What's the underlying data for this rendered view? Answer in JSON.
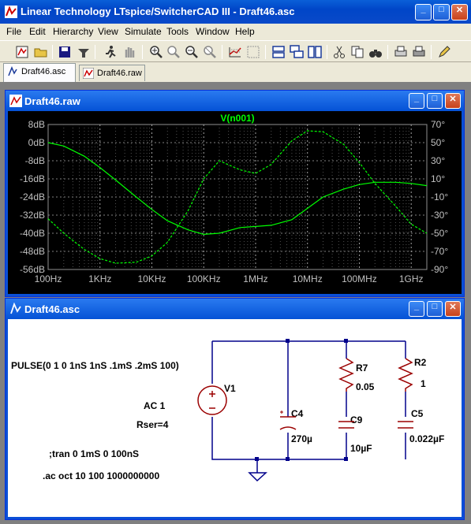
{
  "app": {
    "title": "Linear Technology LTspice/SwitcherCAD III - Draft46.asc"
  },
  "menu": [
    "File",
    "Edit",
    "Hierarchy",
    "View",
    "Simulate",
    "Tools",
    "Window",
    "Help"
  ],
  "toolbar_icons": [
    "new-schematic-icon",
    "open-icon",
    "save-icon",
    "control-panel-icon",
    "run-icon",
    "halt-icon",
    "zoom-in-icon",
    "zoom-out-icon",
    "zoom-fit-icon",
    "zoom-cancel-icon",
    "autorange-icon",
    "grid-icon",
    "tile-horizontal-icon",
    "cascade-icon",
    "tile-vertical-icon",
    "cut-icon",
    "copy-icon",
    "find-icon",
    "print-preview-icon",
    "print-icon",
    "pencil-icon"
  ],
  "tabs": [
    {
      "label": "Draft46.asc",
      "active": true
    },
    {
      "label": "Draft46.raw",
      "active": false
    }
  ],
  "wave_window": {
    "title": "Draft46.raw",
    "trace_label": "V(n001)",
    "trace_color": "#00ff00",
    "y_left_ticks": [
      "8dB",
      "0dB",
      "-8dB",
      "-16dB",
      "-24dB",
      "-32dB",
      "-40dB",
      "-48dB",
      "-56dB"
    ],
    "y_right_ticks": [
      "70°",
      "50°",
      "30°",
      "10°",
      "-10°",
      "-30°",
      "-50°",
      "-70°",
      "-90°"
    ],
    "x_ticks": [
      "100Hz",
      "1KHz",
      "10KHz",
      "100KHz",
      "1MHz",
      "10MHz",
      "100MHz",
      "1GHz"
    ]
  },
  "chart_data": {
    "type": "line",
    "title": "V(n001)",
    "x_scale": "log",
    "xlim": [
      100,
      2000000000
    ],
    "ylim_left": [
      -56,
      8
    ],
    "ylim_right": [
      -90,
      70
    ],
    "series": [
      {
        "name": "V(n001)",
        "axis": "magnitude_dB",
        "style": "solid",
        "x": [
          100,
          200,
          500,
          1000,
          2000,
          5000,
          10000,
          20000,
          50000,
          100000,
          200000,
          500000,
          1000000,
          2000000,
          5000000,
          10000000,
          20000000,
          50000000,
          100000000,
          200000000,
          500000000,
          1000000000,
          2000000000
        ],
        "y": [
          0,
          -1.5,
          -6,
          -11,
          -16.5,
          -24,
          -29.5,
          -34.5,
          -38.5,
          -40.5,
          -40,
          -37.5,
          -37,
          -36.5,
          -34,
          -29,
          -24,
          -20.5,
          -18.5,
          -17.5,
          -17.5,
          -18,
          -19
        ]
      },
      {
        "name": "V(n001)",
        "axis": "phase_deg",
        "style": "dashed",
        "x": [
          100,
          200,
          500,
          1000,
          2000,
          5000,
          10000,
          20000,
          50000,
          100000,
          200000,
          500000,
          1000000,
          2000000,
          5000000,
          10000000,
          20000000,
          50000000,
          100000000,
          200000000,
          500000000,
          1000000000,
          2000000000
        ],
        "y": [
          -34,
          -50,
          -68,
          -78,
          -83,
          -82,
          -75,
          -60,
          -25,
          10,
          30,
          20,
          16,
          26,
          52,
          63,
          62,
          48,
          28,
          5,
          -20,
          -40,
          -50
        ]
      }
    ]
  },
  "schematic_window": {
    "title": "Draft46.asc",
    "directives": {
      "pulse": "PULSE(0 1 0 1nS 1nS .1mS .2mS 100)",
      "ac": "AC 1",
      "rser": "Rser=4",
      "tran": ";tran 0 1mS 0 100nS",
      "acsweep": ".ac oct 10 100 1000000000"
    },
    "components": {
      "v1": "V1",
      "c4_name": "C4",
      "c4_value": "270µ",
      "r7_name": "R7",
      "r7_value": "0.05",
      "c9_name": "C9",
      "c9_value": "10µF",
      "r2_name": "R2",
      "r2_value": "1",
      "c5_name": "C5",
      "c5_value": "0.022µF"
    },
    "wire_color": "#00008b",
    "component_color": "#9b0000"
  }
}
